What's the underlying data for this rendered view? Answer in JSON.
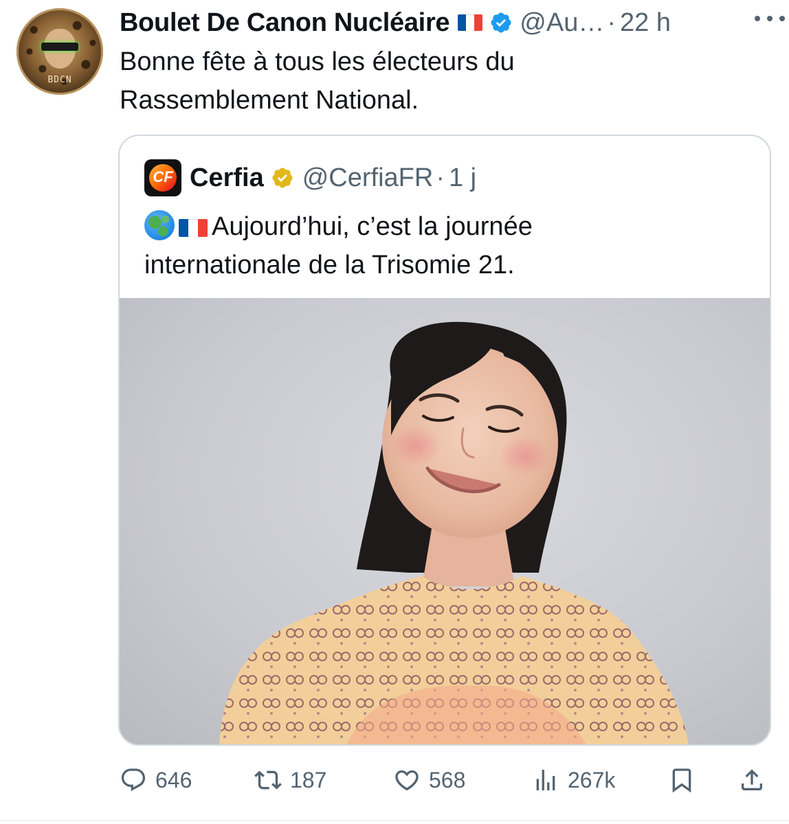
{
  "tweet": {
    "author": {
      "display_name": "Boulet De Canon Nucléaire",
      "handle": "@Au…",
      "time": "22 h",
      "avatar_monogram": "BDCN",
      "flag_colors": [
        "#0055a4",
        "#ffffff",
        "#ef4135"
      ]
    },
    "separator": "·",
    "text_line_1": "Bonne fête à tous les électeurs du",
    "text_line_2": "Rassemblement National.",
    "more_icon": "more-horizontal-icon"
  },
  "quote": {
    "author": {
      "display_name": "Cerfia",
      "handle": "@CerfiaFR",
      "time": "1 j",
      "logo_text": "CF"
    },
    "separator": "·",
    "text_line_1": "Aujourd’hui, c’est la journée",
    "text_line_2": "internationale de la Trisomie 21.",
    "emoji": [
      "globe-icon",
      "france-flag-icon"
    ]
  },
  "actions": {
    "replies": "646",
    "reposts": "187",
    "likes": "568",
    "views": "267k"
  },
  "colors": {
    "verified_blue": "#1d9bf0",
    "verified_gold": "#e2b719",
    "muted": "#536471",
    "border": "#cfd9de"
  }
}
